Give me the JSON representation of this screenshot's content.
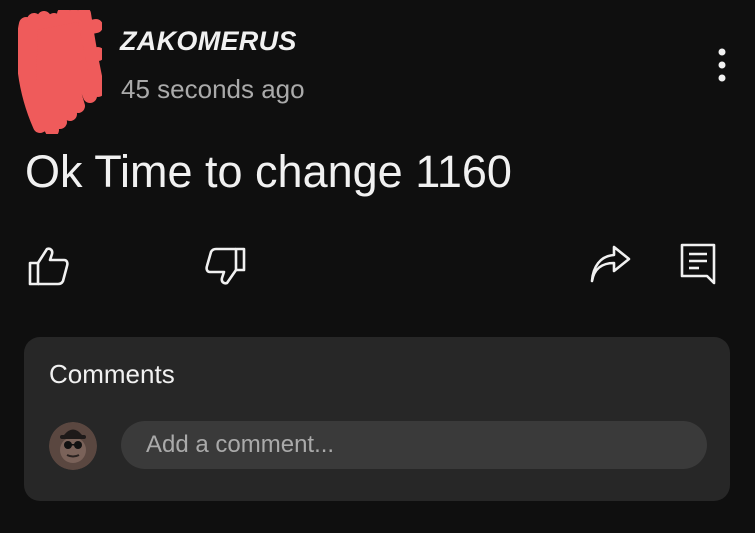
{
  "post": {
    "author": "ZAKOMERUS",
    "timestamp": "45 seconds ago",
    "text": "Ok Time to change 1160"
  },
  "actions": {
    "like_icon": "thumbs-up-icon",
    "dislike_icon": "thumbs-down-icon",
    "share_icon": "share-icon",
    "comment_icon": "comment-icon",
    "more_icon": "more-vertical-icon"
  },
  "comments": {
    "title": "Comments",
    "input_placeholder": "Add a comment..."
  },
  "colors": {
    "background": "#0f0f0f",
    "card": "#272727",
    "input": "#3a3a3a",
    "primary_text": "#f1f1f1",
    "secondary_text": "#aaaaaa",
    "redaction": "#ef5b5b"
  }
}
